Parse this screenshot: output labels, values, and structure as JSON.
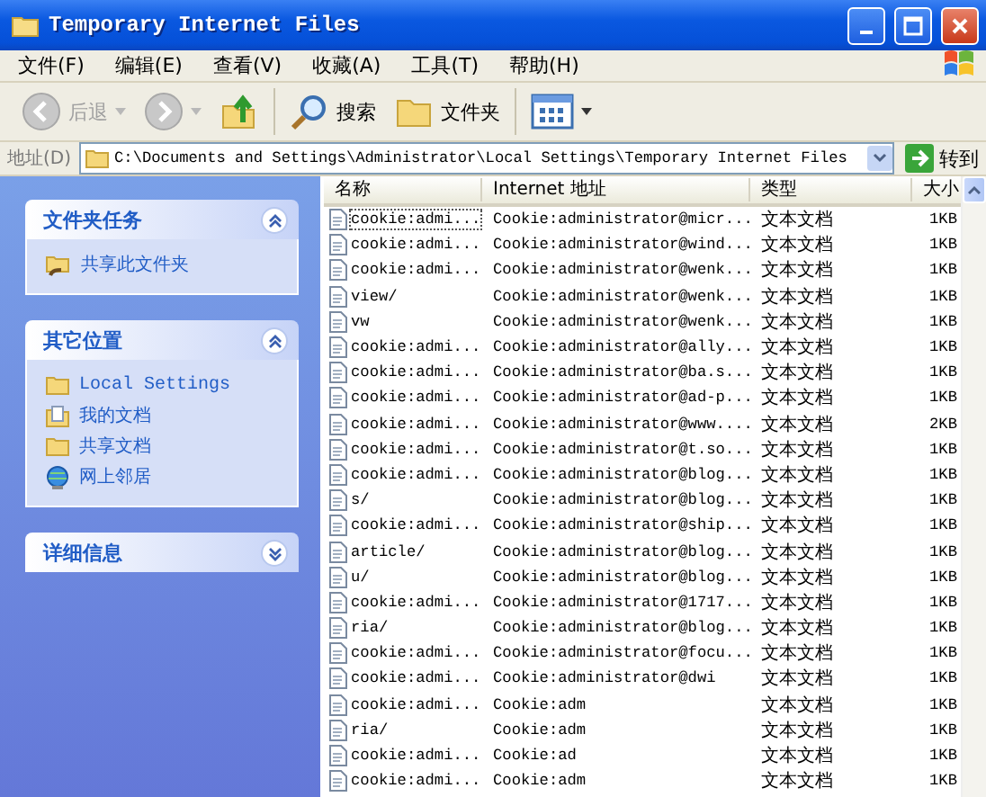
{
  "window": {
    "title": "Temporary Internet Files"
  },
  "menu": [
    {
      "label": "文件(F)"
    },
    {
      "label": "编辑(E)"
    },
    {
      "label": "查看(V)"
    },
    {
      "label": "收藏(A)"
    },
    {
      "label": "工具(T)"
    },
    {
      "label": "帮助(H)"
    }
  ],
  "toolbar": [
    {
      "kind": "back",
      "label": "后退",
      "disabled": true
    },
    {
      "kind": "forward",
      "disabled": true
    },
    {
      "kind": "up"
    },
    {
      "kind": "search",
      "label": "搜索"
    },
    {
      "kind": "folders",
      "label": "文件夹"
    },
    {
      "kind": "views"
    }
  ],
  "address": {
    "label": "地址(D)",
    "value": "C:\\Documents and Settings\\Administrator\\Local Settings\\Temporary Internet Files",
    "go": "转到"
  },
  "task_panes": [
    {
      "title": "文件夹任务",
      "expanded": true,
      "items": [
        {
          "kind": "share",
          "label": "共享此文件夹"
        }
      ]
    },
    {
      "title": "其它位置",
      "expanded": true,
      "items": [
        {
          "kind": "folder",
          "label": "Local Settings"
        },
        {
          "kind": "documents",
          "label": "我的文档"
        },
        {
          "kind": "folder",
          "label": "共享文档"
        },
        {
          "kind": "network",
          "label": "网上邻居"
        }
      ]
    },
    {
      "title": "详细信息",
      "expanded": false
    }
  ],
  "file_list": {
    "columns": [
      "名称",
      "Internet 地址",
      "类型",
      "大小"
    ],
    "rows": [
      {
        "name": "cookie:admi...",
        "address": "Cookie:administrator@micr...",
        "type": "文本文档",
        "size": "1KB",
        "focused": true
      },
      {
        "name": "cookie:admi...",
        "address": "Cookie:administrator@wind...",
        "type": "文本文档",
        "size": "1KB",
        "focused": false
      },
      {
        "name": "cookie:admi...",
        "address": "Cookie:administrator@wenk...",
        "type": "文本文档",
        "size": "1KB",
        "focused": false
      },
      {
        "name": "view/",
        "address": "Cookie:administrator@wenk...",
        "type": "文本文档",
        "size": "1KB",
        "focused": false
      },
      {
        "name": "vw",
        "address": "Cookie:administrator@wenk...",
        "type": "文本文档",
        "size": "1KB",
        "focused": false
      },
      {
        "name": "cookie:admi...",
        "address": "Cookie:administrator@ally...",
        "type": "文本文档",
        "size": "1KB",
        "focused": false
      },
      {
        "name": "cookie:admi...",
        "address": "Cookie:administrator@ba.s...",
        "type": "文本文档",
        "size": "1KB",
        "focused": false
      },
      {
        "name": "cookie:admi...",
        "address": "Cookie:administrator@ad-p...",
        "type": "文本文档",
        "size": "1KB",
        "focused": false
      },
      {
        "name": "cookie:admi...",
        "address": "Cookie:administrator@www....",
        "type": "文本文档",
        "size": "2KB",
        "focused": false
      },
      {
        "name": "cookie:admi...",
        "address": "Cookie:administrator@t.so...",
        "type": "文本文档",
        "size": "1KB",
        "focused": false
      },
      {
        "name": "cookie:admi...",
        "address": "Cookie:administrator@blog...",
        "type": "文本文档",
        "size": "1KB",
        "focused": false
      },
      {
        "name": "s/",
        "address": "Cookie:administrator@blog...",
        "type": "文本文档",
        "size": "1KB",
        "focused": false
      },
      {
        "name": "cookie:admi...",
        "address": "Cookie:administrator@ship...",
        "type": "文本文档",
        "size": "1KB",
        "focused": false
      },
      {
        "name": "article/",
        "address": "Cookie:administrator@blog...",
        "type": "文本文档",
        "size": "1KB",
        "focused": false
      },
      {
        "name": "u/",
        "address": "Cookie:administrator@blog...",
        "type": "文本文档",
        "size": "1KB",
        "focused": false
      },
      {
        "name": "cookie:admi...",
        "address": "Cookie:administrator@1717...",
        "type": "文本文档",
        "size": "1KB",
        "focused": false
      },
      {
        "name": "ria/",
        "address": "Cookie:administrator@blog...",
        "type": "文本文档",
        "size": "1KB",
        "focused": false
      },
      {
        "name": "cookie:admi...",
        "address": "Cookie:administrator@focu...",
        "type": "文本文档",
        "size": "1KB",
        "focused": false
      },
      {
        "name": "cookie:admi...",
        "address": "Cookie:administrator@dwi",
        "type": "文本文档",
        "size": "1KB",
        "focused": false
      },
      {
        "name": "cookie:admi...",
        "address": "Cookie:adm",
        "type": "文本文档",
        "size": "1KB",
        "focused": false
      },
      {
        "name": "ria/",
        "address": "Cookie:adm",
        "type": "文本文档",
        "size": "1KB",
        "focused": false
      },
      {
        "name": "cookie:admi...",
        "address": "Cookie:ad",
        "type": "文本文档",
        "size": "1KB",
        "focused": false
      },
      {
        "name": "cookie:admi...",
        "address": "Cookie:adm",
        "type": "文本文档",
        "size": "1KB",
        "focused": false
      }
    ]
  }
}
